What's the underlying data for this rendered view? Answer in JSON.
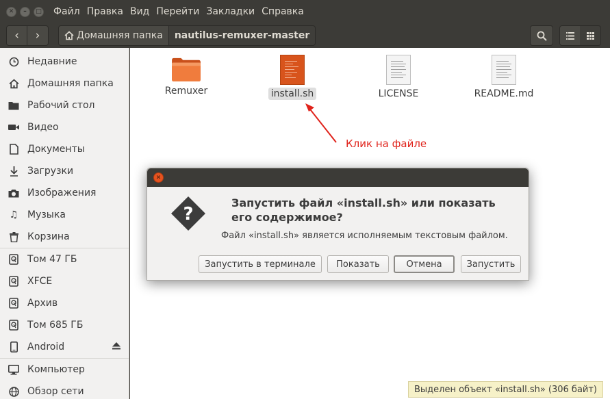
{
  "menubar": {
    "items": [
      "Файл",
      "Правка",
      "Вид",
      "Перейти",
      "Закладки",
      "Справка"
    ]
  },
  "toolbar": {
    "path_home": "Домашняя папка",
    "path_current": "nautilus-remuxer-master"
  },
  "sidebar": {
    "items": [
      {
        "label": "Недавние",
        "icon": "clock-icon"
      },
      {
        "label": "Домашняя папка",
        "icon": "home-icon"
      },
      {
        "label": "Рабочий стол",
        "icon": "desktop-folder-icon"
      },
      {
        "label": "Видео",
        "icon": "video-icon"
      },
      {
        "label": "Документы",
        "icon": "document-icon"
      },
      {
        "label": "Загрузки",
        "icon": "download-icon"
      },
      {
        "label": "Изображения",
        "icon": "camera-icon"
      },
      {
        "label": "Музыка",
        "icon": "music-icon"
      },
      {
        "label": "Корзина",
        "icon": "trash-icon"
      }
    ],
    "devices": [
      {
        "label": "Том 47 ГБ",
        "icon": "drive-icon"
      },
      {
        "label": "XFCE",
        "icon": "drive-icon"
      },
      {
        "label": "Архив",
        "icon": "drive-icon"
      },
      {
        "label": "Том 685 ГБ",
        "icon": "drive-icon"
      },
      {
        "label": "Android",
        "icon": "phone-icon"
      }
    ],
    "network": [
      {
        "label": "Компьютер",
        "icon": "computer-icon"
      },
      {
        "label": "Обзор сети",
        "icon": "network-icon"
      }
    ]
  },
  "files": [
    {
      "name": "Remuxer",
      "icon": "folder-icon"
    },
    {
      "name": "install.sh",
      "icon": "script-icon"
    },
    {
      "name": "LICENSE",
      "icon": "text-file-icon"
    },
    {
      "name": "README.md",
      "icon": "text-file-icon"
    }
  ],
  "annotation": "Клик на файле",
  "dialog": {
    "heading_line1": "Запустить файл «install.sh» или показать",
    "heading_line2": "его содержимое?",
    "subtitle": "Файл «install.sh» является исполняемым текстовым файлом.",
    "buttons": [
      "Запустить в терминале",
      "Показать",
      "Отмена",
      "Запустить"
    ]
  },
  "statusbar": "Выделен объект «install.sh» (306 байт)",
  "colors": {
    "accent_orange": "#e6531f",
    "annotation_red": "#e0231b",
    "title_bar": "#3c3b37"
  }
}
